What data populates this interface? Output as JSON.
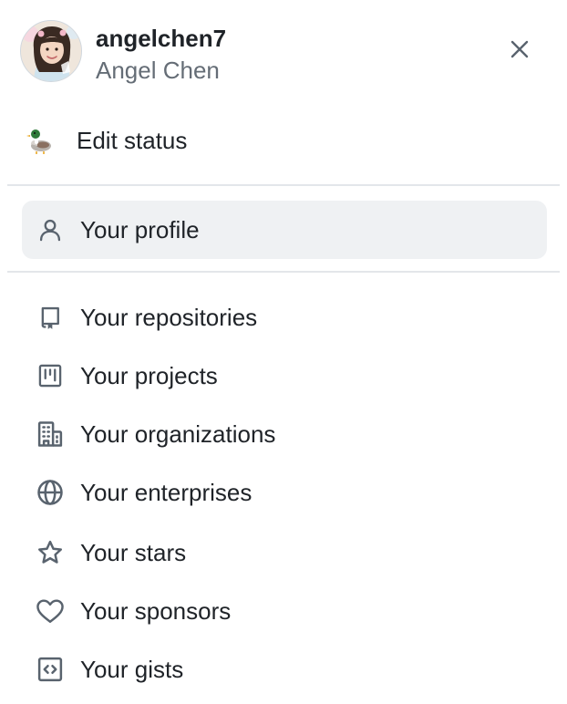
{
  "header": {
    "username": "angelchen7",
    "full_name": "Angel Chen",
    "avatar_icon": "user-avatar",
    "close_icon": "close-icon"
  },
  "status": {
    "emoji_icon": "duck-emoji",
    "label": "Edit status"
  },
  "profile_item": {
    "icon": "person-icon",
    "label": "Your profile",
    "active": true
  },
  "menu": {
    "items": [
      {
        "icon": "repo-icon",
        "label": "Your repositories"
      },
      {
        "icon": "project-icon",
        "label": "Your projects"
      },
      {
        "icon": "organization-icon",
        "label": "Your organizations"
      },
      {
        "icon": "globe-icon",
        "label": "Your enterprises"
      },
      {
        "icon": "star-icon",
        "label": "Your stars"
      },
      {
        "icon": "heart-icon",
        "label": "Your sponsors"
      },
      {
        "icon": "code-square-icon",
        "label": "Your gists"
      }
    ]
  },
  "colors": {
    "text_primary": "#1f2328",
    "text_secondary": "#656d76",
    "icon": "#59636e",
    "active_bg": "#eff1f3",
    "divider": "#e3e6ea"
  }
}
